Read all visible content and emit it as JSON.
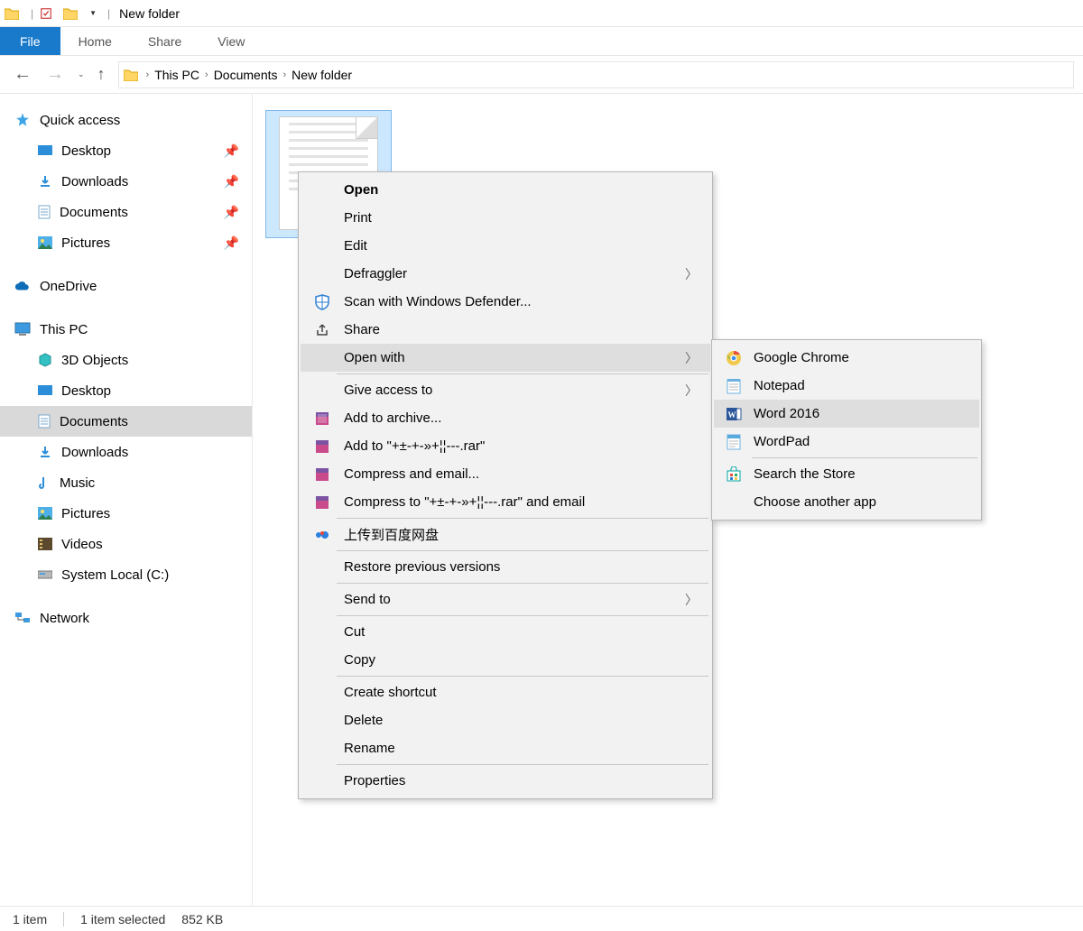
{
  "window": {
    "title": "New folder"
  },
  "ribbon": {
    "file": "File",
    "home": "Home",
    "share": "Share",
    "view": "View"
  },
  "breadcrumb": {
    "p0": "This PC",
    "p1": "Documents",
    "p2": "New folder"
  },
  "sidebar": {
    "quick_access": "Quick access",
    "desktop": "Desktop",
    "downloads": "Downloads",
    "documents": "Documents",
    "pictures": "Pictures",
    "onedrive": "OneDrive",
    "this_pc": "This PC",
    "objects_3d": "3D Objects",
    "desktop2": "Desktop",
    "documents2": "Documents",
    "downloads2": "Downloads",
    "music": "Music",
    "pictures2": "Pictures",
    "videos": "Videos",
    "system_local": "System Local (C:)",
    "network": "Network"
  },
  "context": {
    "open": "Open",
    "print": "Print",
    "edit": "Edit",
    "defraggler": "Defraggler",
    "scan_defender": "Scan with Windows Defender...",
    "share": "Share",
    "open_with": "Open with",
    "give_access": "Give access to",
    "add_archive": "Add to archive...",
    "add_to_rar": "Add to \"+±-+-»+¦¦---.rar\"",
    "compress_email": "Compress and email...",
    "compress_to_rar_email": "Compress to \"+±-+-»+¦¦---.rar\" and email",
    "baidu": "上传到百度网盘",
    "restore_prev": "Restore previous versions",
    "send_to": "Send to",
    "cut": "Cut",
    "copy": "Copy",
    "create_shortcut": "Create shortcut",
    "delete": "Delete",
    "rename": "Rename",
    "properties": "Properties"
  },
  "submenu": {
    "chrome": "Google Chrome",
    "notepad": "Notepad",
    "word": "Word 2016",
    "wordpad": "WordPad",
    "search_store": "Search the Store",
    "choose_another": "Choose another app"
  },
  "status": {
    "item_count": "1 item",
    "selected": "1 item selected",
    "size": "852 KB"
  }
}
